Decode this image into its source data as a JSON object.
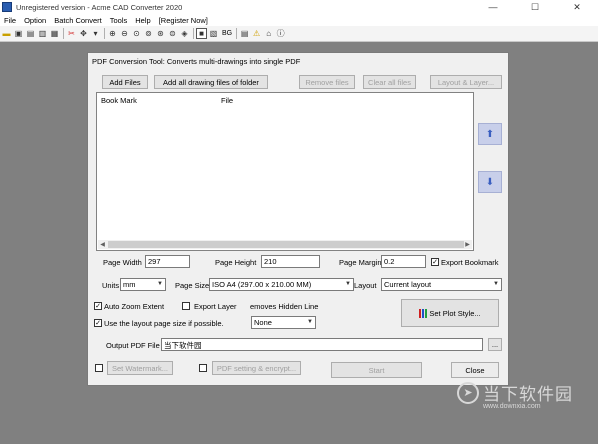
{
  "app": {
    "title": "Unregistered version - Acme CAD Converter 2020",
    "controls": {
      "minimize": "—",
      "maximize": "☐",
      "close": "✕"
    }
  },
  "menu": [
    "File",
    "Option",
    "Batch Convert",
    "Tools",
    "Help",
    "[Register Now]"
  ],
  "toolbar": {
    "bg_label": "BG"
  },
  "dialog": {
    "title": "PDF Conversion Tool: Converts multi-drawings into single PDF",
    "buttons": {
      "add_files": "Add Files",
      "add_folder": "Add all drawing files of folder",
      "remove_files": "Remove files",
      "clear_all": "Clear all files",
      "layout_layer": "Layout & Layer...",
      "set_plot_style": "Set Plot Style...",
      "browse": "...",
      "set_watermark": "Set Watermark...",
      "pdf_setting": "PDF setting & encrypt...",
      "start": "Start",
      "close": "Close"
    },
    "list_headers": {
      "bookmark": "Book Mark",
      "file": "File"
    },
    "fields": {
      "page_width_label": "Page Width",
      "page_width": "297",
      "page_height_label": "Page Height",
      "page_height": "210",
      "page_margin_label": "Page Margin",
      "page_margin": "0.2",
      "export_bookmark": "Export Bookmark",
      "units_label": "Units",
      "units": "mm",
      "page_size_label": "Page Size",
      "page_size": "ISO A4 (297.00 x 210.00 MM)",
      "layout_label": "Layout",
      "layout": "Current layout",
      "auto_zoom": "Auto Zoom Extent",
      "export_layer": "Export Layer",
      "removes_hidden": "emoves Hidden Line",
      "use_layout_size": "Use the layout page size if possible.",
      "hidden_line_option": "None",
      "output_label": "Output PDF File",
      "output_value": "当下软件园"
    },
    "checks": {
      "export_bookmark": true,
      "auto_zoom": true,
      "export_layer": false,
      "use_layout_size": true,
      "watermark": false,
      "pdf_setting": false
    }
  },
  "watermark": {
    "big": "当下软件园",
    "small": "www.downxia.com"
  },
  "colors": {
    "desktop": "#808080",
    "dialog": "#f0f0f0",
    "arrow": "#3a5fc0"
  }
}
